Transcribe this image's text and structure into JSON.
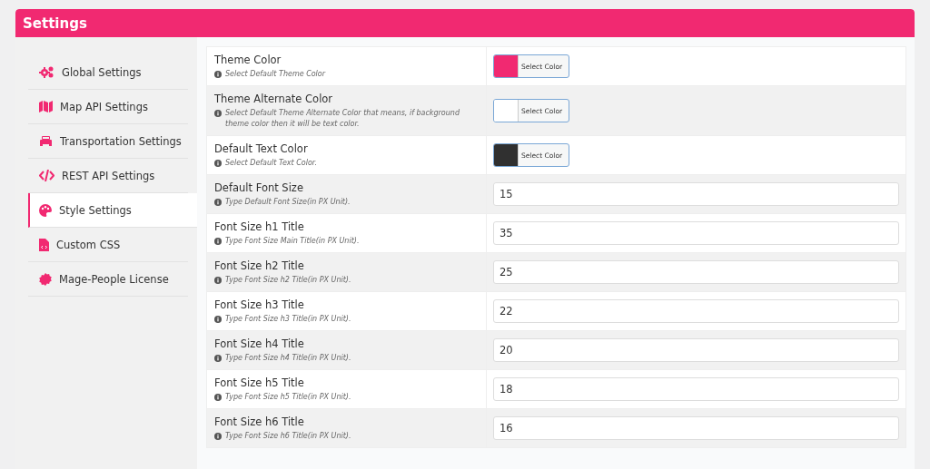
{
  "header": {
    "title": "Settings"
  },
  "sidebar": {
    "items": [
      {
        "label": "Global Settings",
        "selected": false
      },
      {
        "label": "Map API Settings",
        "selected": false
      },
      {
        "label": "Transportation Settings",
        "selected": false
      },
      {
        "label": "REST API Settings",
        "selected": false
      },
      {
        "label": "Style Settings",
        "selected": true
      },
      {
        "label": "Custom CSS",
        "selected": false
      },
      {
        "label": "Mage-People License",
        "selected": false
      }
    ]
  },
  "settings": [
    {
      "kind": "color",
      "label": "Theme Color",
      "hint": "Select Default Theme Color",
      "color": "#f12971",
      "button": "Select Color"
    },
    {
      "kind": "color",
      "label": "Theme Alternate Color",
      "hint": "Select Default Theme Alternate Color that means, if background theme color then it will be text color.",
      "color": "#ffffff",
      "button": "Select Color"
    },
    {
      "kind": "color",
      "label": "Default Text Color",
      "hint": "Select Default Text Color.",
      "color": "#303030",
      "button": "Select Color"
    },
    {
      "kind": "number",
      "label": "Default Font Size",
      "hint": "Type Default Font Size(in PX Unit).",
      "value": "15"
    },
    {
      "kind": "number",
      "label": "Font Size h1 Title",
      "hint": "Type Font Size Main Title(in PX Unit).",
      "value": "35"
    },
    {
      "kind": "number",
      "label": "Font Size h2 Title",
      "hint": "Type Font Size h2 Title(in PX Unit).",
      "value": "25"
    },
    {
      "kind": "number",
      "label": "Font Size h3 Title",
      "hint": "Type Font Size h3 Title(in PX Unit).",
      "value": "22"
    },
    {
      "kind": "number",
      "label": "Font Size h4 Title",
      "hint": "Type Font Size h4 Title(in PX Unit).",
      "value": "20"
    },
    {
      "kind": "number",
      "label": "Font Size h5 Title",
      "hint": "Type Font Size h5 Title(in PX Unit).",
      "value": "18"
    },
    {
      "kind": "number",
      "label": "Font Size h6 Title",
      "hint": "Type Font Size h6 Title(in PX Unit).",
      "value": "16"
    }
  ]
}
